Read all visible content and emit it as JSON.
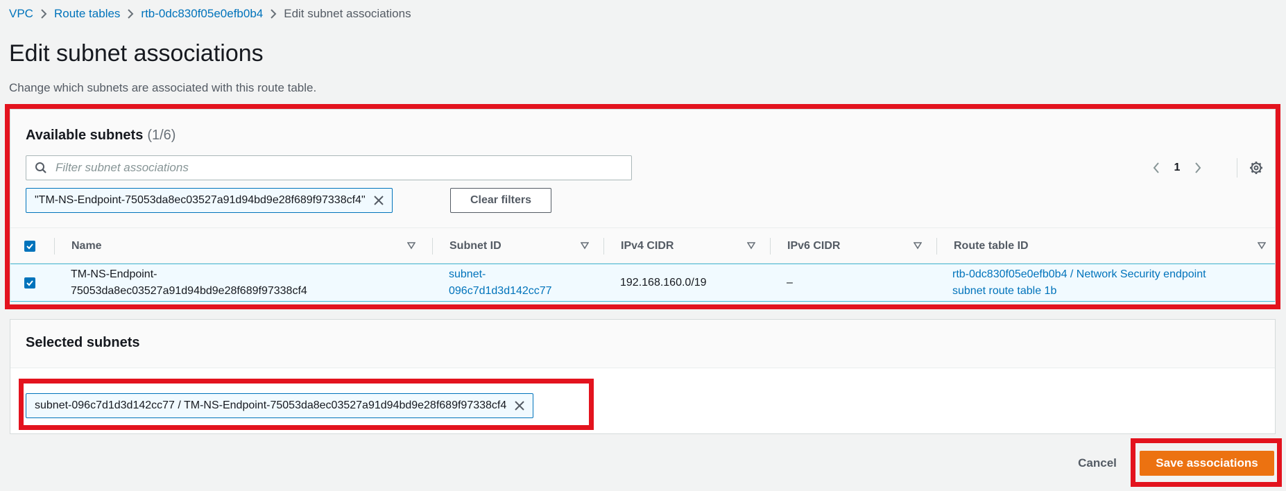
{
  "breadcrumb": {
    "items": [
      "VPC",
      "Route tables",
      "rtb-0dc830f05e0efb0b4"
    ],
    "current": "Edit subnet associations"
  },
  "page": {
    "title": "Edit subnet associations",
    "description": "Change which subnets are associated with this route table."
  },
  "available": {
    "title": "Available subnets",
    "count": "(1/6)",
    "search_placeholder": "Filter subnet associations",
    "filter_token": "\"TM-NS-Endpoint-75053da8ec03527a91d94bd9e28f689f97338cf4\"",
    "clear_filters_label": "Clear filters",
    "page_number": "1",
    "columns": [
      "Name",
      "Subnet ID",
      "IPv4 CIDR",
      "IPv6 CIDR",
      "Route table ID"
    ],
    "rows": [
      {
        "selected": true,
        "name_line1": "TM-NS-Endpoint-",
        "name_line2": "75053da8ec03527a91d94bd9e28f689f97338cf4",
        "subnet_line1": "subnet-",
        "subnet_line2": "096c7d1d3d142cc77",
        "ipv4": "192.168.160.0/19",
        "ipv6": "–",
        "route_line1": "rtb-0dc830f05e0efb0b4 / Network Security endpoint",
        "route_line2": "subnet route table 1b"
      }
    ]
  },
  "selected": {
    "title": "Selected subnets",
    "token": "subnet-096c7d1d3d142cc77 / TM-NS-Endpoint-75053da8ec03527a91d94bd9e28f689f97338cf4"
  },
  "actions": {
    "cancel_label": "Cancel",
    "save_label": "Save associations"
  },
  "colors": {
    "link": "#0073bb",
    "primary": "#ec7211",
    "highlight": "#e3131e",
    "selected_row": "#f1faff"
  },
  "icons": [
    "chevron-right-icon",
    "search-icon",
    "close-icon",
    "chevron-left-icon",
    "gear-icon",
    "sort-down-icon",
    "checkbox-checked-icon"
  ]
}
